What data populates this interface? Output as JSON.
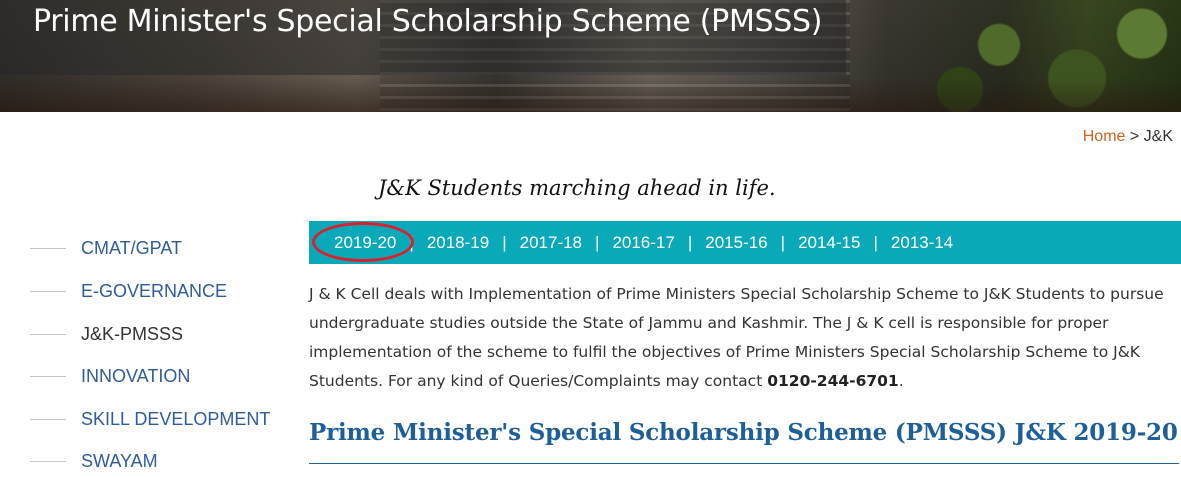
{
  "header": {
    "title": "Prime Minister's Special Scholarship Scheme (PMSSS)"
  },
  "breadcrumb": {
    "home": "Home",
    "separator": " > ",
    "current": "J&K"
  },
  "tagline": "J&K Students marching ahead in life.",
  "sidebar": {
    "items": [
      {
        "label": "CMAT/GPAT"
      },
      {
        "label": "E-GOVERNANCE"
      },
      {
        "label": "J&K-PMSSS",
        "active": true
      },
      {
        "label": "INNOVATION"
      },
      {
        "label": "SKILL DEVELOPMENT"
      },
      {
        "label": "SWAYAM"
      }
    ]
  },
  "year_tabs": {
    "tabs": [
      "2019-20",
      "2018-19",
      "2017-18",
      "2016-17",
      "2015-16",
      "2014-15",
      "2013-14"
    ],
    "separator": "|",
    "highlighted": "2019-20"
  },
  "description": {
    "text": "J & K Cell deals with Implementation of Prime Ministers Special Scholarship Scheme to J&K Students to pursue undergraduate studies outside the State of Jammu and Kashmir. The J & K cell is responsible for proper implementation of the scheme to fulfil the objectives of Prime Ministers Special Scholarship Scheme to J&K Students. For any kind of Queries/Complaints may contact ",
    "phone": "0120-244-6701",
    "end": "."
  },
  "section": {
    "heading": "Prime Minister's Special Scholarship Scheme (PMSSS) J&K 2019-20"
  },
  "colors": {
    "year_bar": "#0aa9ba",
    "link": "#2e5d9a",
    "heading": "#1f5f98",
    "home_link": "#d2621e",
    "highlight_circle": "#d8212c"
  }
}
